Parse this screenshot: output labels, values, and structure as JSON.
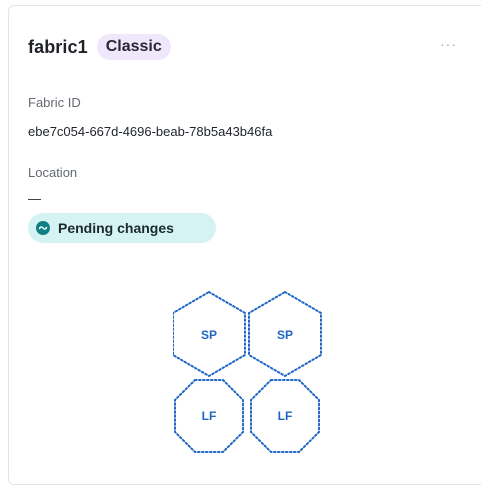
{
  "card": {
    "title": "fabric1",
    "badge": "Classic",
    "more_label": "···",
    "fabric_id_label": "Fabric ID",
    "fabric_id_value": "ebe7c054-667d-4696-beab-78b5a43b46fa",
    "location_label": "Location",
    "location_value": "—",
    "status": "Pending changes",
    "status_icon": "pending-changes-icon"
  },
  "topology": {
    "spines": [
      "SP",
      "SP"
    ],
    "leaves": [
      "LF",
      "LF"
    ]
  },
  "colors": {
    "badge_bg": "#efe7fb",
    "status_bg": "#d5f3f3",
    "status_icon": "#0f7f84",
    "node_outline": "#1f66c6"
  }
}
